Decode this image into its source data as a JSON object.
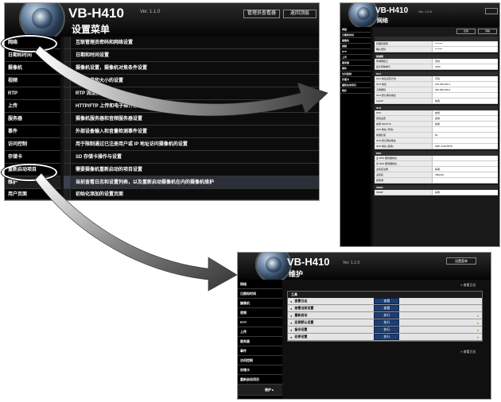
{
  "model": "VB-H410",
  "version": "Ver. 1.1.0",
  "ver_short": "Ver. 1.0.0",
  "main": {
    "title": "设置菜单",
    "top_buttons": [
      "管理员查看器",
      "返回顶层"
    ],
    "nav": [
      "网络",
      "日期和时间",
      "摄像机",
      "视频",
      "RTP",
      "上传",
      "服务器",
      "事件",
      "访问控制",
      "存储卡",
      "重新启动项目",
      "维护",
      "用户页面"
    ],
    "items": [
      "互联管理员密码和网络设置",
      "日期和时间设置",
      "摄像机设置，摄像机对焦条件设置",
      "视频质量和大小的设置",
      "RTP 流设置",
      "HTTP/FTP 上传和电子邮件通知设置",
      "摄像机服务器和音频服务器设置",
      "外部设备输入和音量检测事件设置",
      "用于限制通过已注册用户或 IP 地址访问摄像机的设置",
      "SD 存储卡操作与设置",
      "需要摄像机重新启动的项目设置",
      "当前查看日志和设置列表，以及重新启动摄像机在内的摄像机维护",
      "初始化添加的设置页面"
    ]
  },
  "network": {
    "title": "网络",
    "tabs": [
      "应用",
      "清除"
    ],
    "help": "帮助",
    "sections": [
      {
        "name": "",
        "rows": [
          [
            "管理员密码",
            "********"
          ],
          [
            "确认密码",
            "********"
          ]
        ]
      },
      {
        "name": "局域网",
        "rows": [
          [
            "局域网接口",
            "自动"
          ],
          [
            "最大传输单元",
            "1500"
          ]
        ]
      },
      {
        "name": "IPv4",
        "rows": [
          [
            "IPv4 地址设定方法",
            "手动"
          ],
          [
            "IPv4 地址",
            "192.168.100.1"
          ],
          [
            "子网掩码",
            "255.255.255.0"
          ],
          [
            "IPv4 默认网关地址",
            ""
          ],
          [
            "AutoIP",
            "启用"
          ]
        ]
      },
      {
        "name": "IPv6",
        "rows": [
          [
            "IPv6",
            "启用"
          ],
          [
            "自动设置",
            "启用"
          ],
          [
            "启用 DHCPv6",
            "启用"
          ],
          [
            "IPv6 地址 (手动)",
            ""
          ],
          [
            "前缀长度",
            "64"
          ],
          [
            "IPv6 默认网关地址",
            ""
          ],
          [
            "IPv6 地址 (自动)",
            "fe80::1234:5678"
          ]
        ]
      },
      {
        "name": "DNS",
        "rows": [
          [
            "主 DNS 服务器地址",
            ""
          ],
          [
            "次 DNS 服务器地址",
            ""
          ],
          [
            "主机名注册",
            "禁用"
          ],
          [
            "主机名",
            "VBH410"
          ],
          [
            "搜索域",
            ""
          ]
        ]
      },
      {
        "name": "SNMP",
        "rows": [
          [
            "SNMP",
            "禁用"
          ]
        ]
      }
    ]
  },
  "maint": {
    "title": "维护",
    "top_button": "设置菜单",
    "table_title": "工具",
    "help_text": "查看日志",
    "rows": [
      {
        "label": "查看日志",
        "btn": "查看"
      },
      {
        "label": "查看当前设置",
        "btn": "查看"
      },
      {
        "label": "重新启动",
        "btn": "执行"
      },
      {
        "label": "还原默认设置",
        "btn": "执行"
      },
      {
        "label": "备份设置",
        "btn": "执行"
      },
      {
        "label": "还原设置",
        "btn": "执行"
      }
    ],
    "warning_mark": "●",
    "footer_help": "查看日志",
    "back_label": "维护 ▸"
  },
  "colors": {
    "accent": "#1d3f72",
    "warning": "#e07000"
  }
}
